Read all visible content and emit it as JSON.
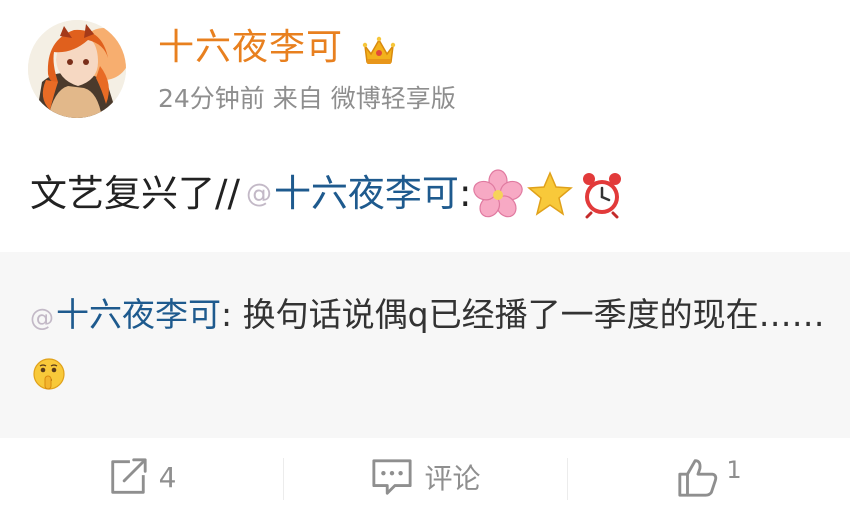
{
  "author": {
    "name": "十六夜李可",
    "badge_icon": "crown-icon",
    "avatar": "anime-avatar"
  },
  "meta": {
    "time": "24分钟前",
    "from_label": "来自",
    "client": "微博轻享版"
  },
  "post": {
    "text": "文艺复兴了",
    "separator": "//",
    "at": "@",
    "mention": "十六夜李可",
    "colon": ":",
    "emojis": [
      "cherry-blossom-icon",
      "star-icon",
      "alarm-clock-icon"
    ]
  },
  "quoted": {
    "at": "@",
    "mention": "十六夜李可",
    "colon": ":",
    "text": "换句话说偶q已经播了一季度的现在……",
    "emoji": "shushing-face-icon"
  },
  "actions": {
    "repost_count": "4",
    "comment_label": "评论",
    "like_count": "1"
  },
  "colors": {
    "username": "#e8801f",
    "mention": "#1e5a8e",
    "meta": "#8e8e8e",
    "quote_bg": "#f7f7f7"
  }
}
